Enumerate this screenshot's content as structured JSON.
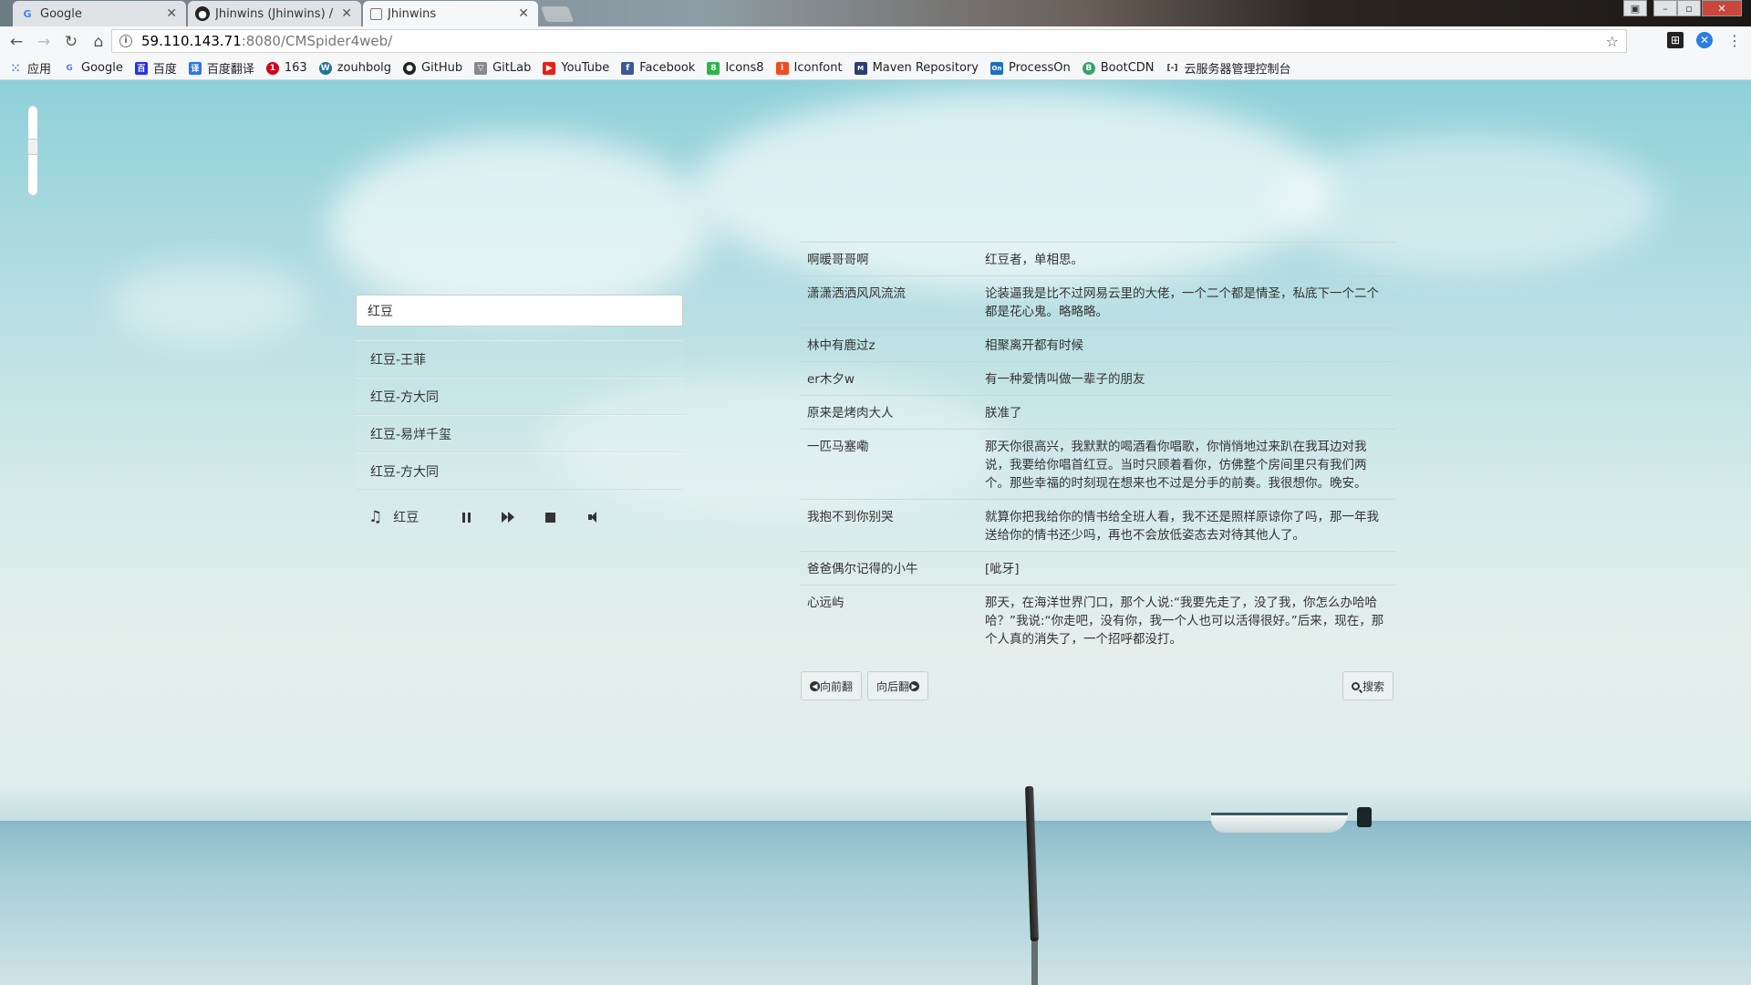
{
  "browser": {
    "tabs": [
      {
        "title": "Google",
        "favicon": "G"
      },
      {
        "title": "Jhinwins (Jhinwins) / Ju",
        "favicon": "github"
      },
      {
        "title": "Jhinwins",
        "favicon": "page"
      }
    ],
    "url_host": "59.110.143.71",
    "url_path": ":8080/CMSpider4web/",
    "bookmarks": [
      {
        "label": "应用",
        "icon": "apps-icon",
        "color": "#4285f4"
      },
      {
        "label": "Google",
        "icon": "google-icon",
        "color": "#4285f4"
      },
      {
        "label": "百度",
        "icon": "baidu-icon",
        "color": "#2932e1"
      },
      {
        "label": "百度翻译",
        "icon": "baidu-translate-icon",
        "color": "#2d77e6"
      },
      {
        "label": "163",
        "icon": "163-icon",
        "color": "#d0021b"
      },
      {
        "label": "zouhbolg",
        "icon": "wordpress-icon",
        "color": "#21759b"
      },
      {
        "label": "GitHub",
        "icon": "github-icon",
        "color": "#222222"
      },
      {
        "label": "GitLab",
        "icon": "gitlab-icon",
        "color": "#8a8a8a"
      },
      {
        "label": "YouTube",
        "icon": "youtube-icon",
        "color": "#e62117"
      },
      {
        "label": "Facebook",
        "icon": "facebook-icon",
        "color": "#3b5998"
      },
      {
        "label": "Icons8",
        "icon": "icons8-icon",
        "color": "#32b34a"
      },
      {
        "label": "Iconfont",
        "icon": "iconfont-icon",
        "color": "#f04b23"
      },
      {
        "label": "Maven Repository",
        "icon": "maven-icon",
        "color": "#2c3e76"
      },
      {
        "label": "ProcessOn",
        "icon": "processon-icon",
        "color": "#1e6fc4"
      },
      {
        "label": "BootCDN",
        "icon": "bootcdn-icon",
        "color": "#38a169"
      },
      {
        "label": "云服务器管理控制台",
        "icon": "aliyun-icon",
        "color": "#333333"
      }
    ]
  },
  "search": {
    "value": "红豆"
  },
  "songs": [
    "红豆-王菲",
    "红豆-方大同",
    "红豆-易烊千玺",
    "红豆-方大同"
  ],
  "player": {
    "now_playing": "红豆",
    "volume_level": 0.55
  },
  "comments": [
    {
      "user": "啊暖哥哥啊",
      "text": "红豆者，单相思。"
    },
    {
      "user": "潇潇洒洒风风流流",
      "text": "论装逼我是比不过网易云里的大佬，一个二个都是情圣，私底下一个二个都是花心鬼。略略略。"
    },
    {
      "user": "林中有鹿过z",
      "text": "相聚离开都有时候"
    },
    {
      "user": "er木夕w",
      "text": "有一种爱情叫做一辈子的朋友"
    },
    {
      "user": "原来是烤肉大人",
      "text": "朕准了"
    },
    {
      "user": "一匹马塞嘞",
      "text": "那天你很高兴，我默默的喝酒看你唱歌，你悄悄地过来趴在我耳边对我说，我要给你唱首红豆。当时只顾着看你，仿佛整个房间里只有我们两个。那些幸福的时刻现在想来也不过是分手的前奏。我很想你。晚安。"
    },
    {
      "user": "我抱不到你别哭",
      "text": "就算你把我给你的情书给全班人看，我不还是照样原谅你了吗，那一年我送给你的情书还少吗，再也不会放低姿态去对待其他人了。"
    },
    {
      "user": "爸爸偶尔记得的小牛",
      "text": "[呲牙]"
    },
    {
      "user": "心远屿",
      "text": "那天，在海洋世界门口，那个人说:“我要先走了，没了我，你怎么办哈哈哈？”我说:“你走吧，没有你，我一个人也可以活得很好。”后来，现在，那个人真的消失了，一个招呼都没打。"
    }
  ],
  "pager": {
    "prev": "向前翻",
    "next": "向后翻",
    "search": "搜索"
  }
}
